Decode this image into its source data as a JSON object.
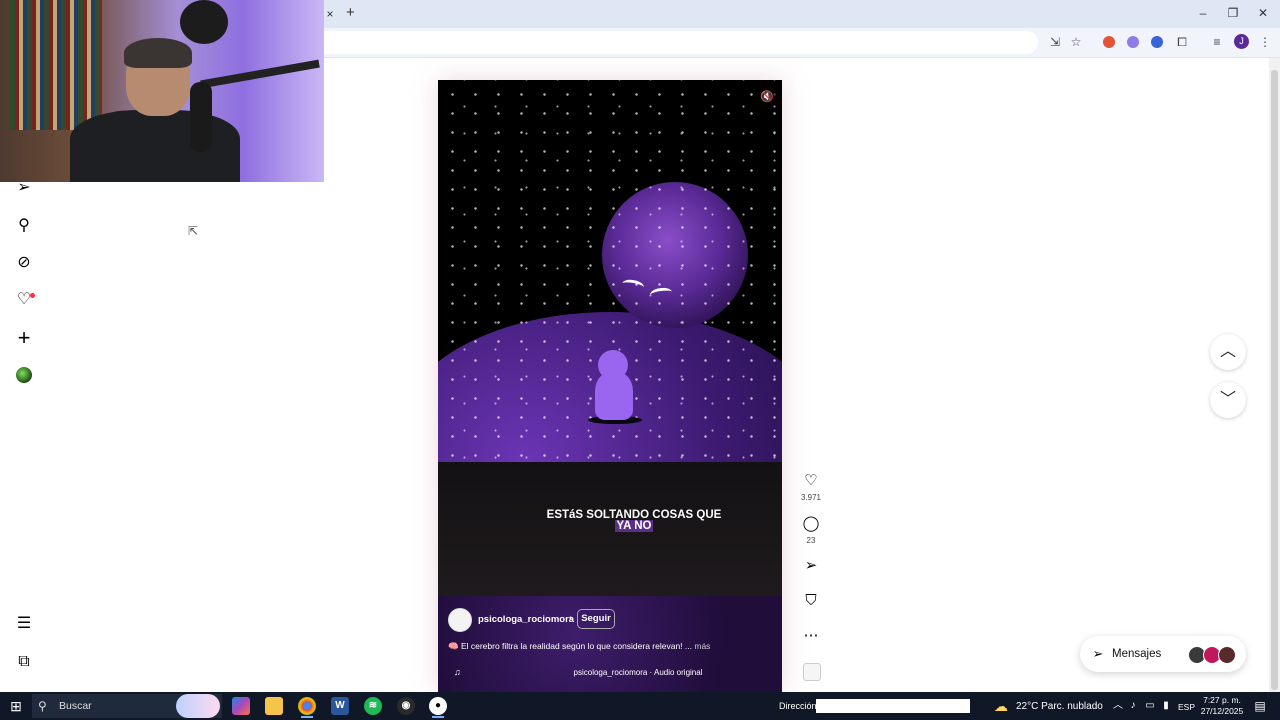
{
  "browser": {
    "tab_close": "×",
    "new_tab": "+",
    "window_controls": [
      "–",
      "❐",
      "✕"
    ],
    "profile_initial": "J",
    "extension_colors": [
      "#e2533a",
      "#8f7ae8",
      "#3a63d6"
    ]
  },
  "instagram_nav": {
    "items": [
      {
        "icon": "paper-plane-icon",
        "glyph": "➢"
      },
      {
        "icon": "search-icon",
        "glyph": "⚲"
      },
      {
        "icon": "compass-icon",
        "glyph": "⊘"
      },
      {
        "icon": "heart-icon",
        "glyph": "♡"
      },
      {
        "icon": "plus-icon",
        "glyph": "+"
      },
      {
        "icon": "menu-icon",
        "glyph": "☰"
      },
      {
        "icon": "meta-icon",
        "glyph": "⧉"
      }
    ],
    "notification_dot_color": "#ff3040"
  },
  "reel": {
    "caption_line1": "ESTáS SOLTANDO COSAS QUE",
    "caption_line2": "YA NO",
    "mute_glyph": "🔇",
    "owner": "psicologa_rociomora",
    "separator": "•",
    "follow_label": "Seguir",
    "description": "🧠 El cerebro filtra la realidad según lo que considera relevan! ...",
    "more_label": "más",
    "audio_glyph": "♫",
    "audio_text": "psicologa_rociomora · Audio original",
    "accent_color": "#5b2e8a"
  },
  "actions": {
    "like_glyph": "♡",
    "like_count": "3.971",
    "comment_glyph": "◯",
    "comment_count": "23",
    "share_glyph": "➢",
    "save_glyph": "⛉",
    "more_glyph": "⋯"
  },
  "navigation": {
    "up_glyph": "︿",
    "down_glyph": "﹀"
  },
  "messages": {
    "icon_glyph": "➢",
    "label": "Mensajes"
  },
  "taskbar": {
    "start_glyph": "⊞",
    "search_placeholder": "Buscar",
    "direccion_label": "Dirección",
    "weather": "22°C  Parc. nublado",
    "language": "ESP",
    "time": "7:27 p. m.",
    "date": "27/12/2025",
    "notif_glyph": "▤"
  }
}
